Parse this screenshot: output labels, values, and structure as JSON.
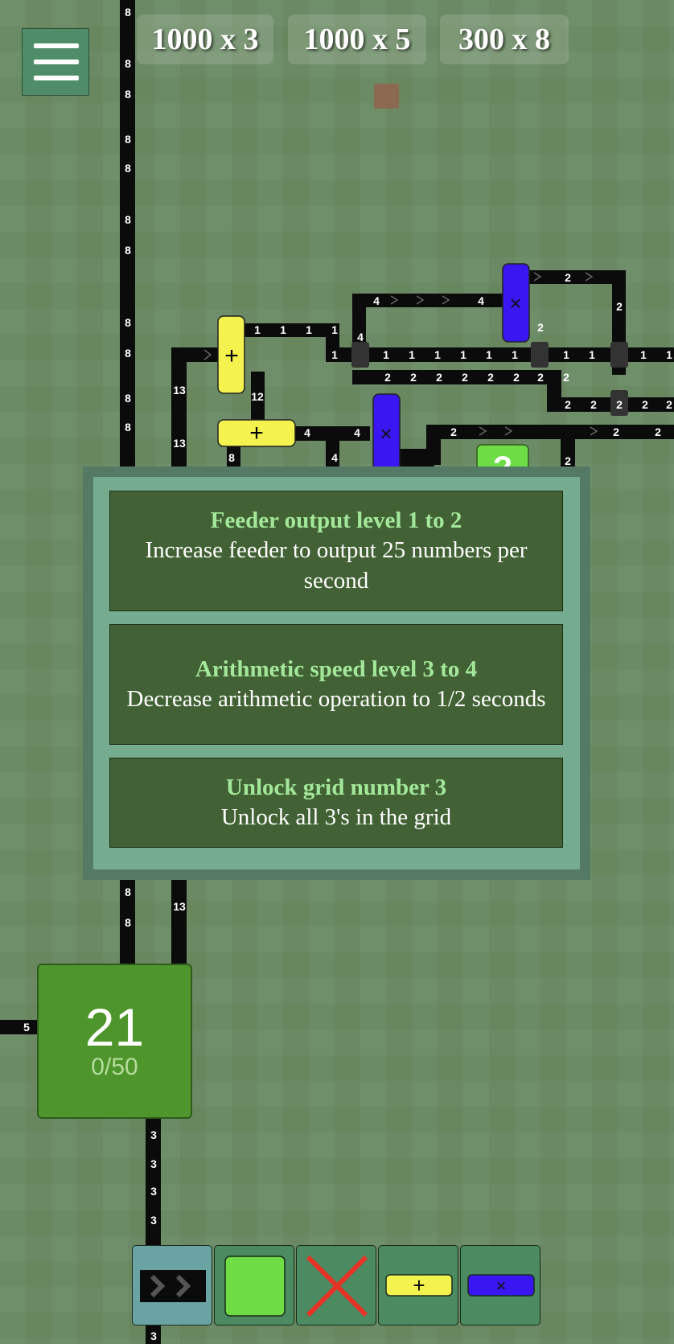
{
  "top_bar": {
    "options": [
      {
        "label": "1000 x 3"
      },
      {
        "label": "1000 x 5"
      },
      {
        "label": "300 x 8"
      }
    ]
  },
  "board": {
    "belt_labels": {
      "main_left": "8",
      "second_left": "13",
      "goal_feed_left": "5",
      "goal_out": "3",
      "top_row_ones": "1",
      "top_row_fours": "4",
      "twos": "2",
      "twelve": "12",
      "eight_small": "8",
      "four_small": "4",
      "mystery_machine": "?"
    },
    "operators": {
      "plus": "+",
      "multiply": "×"
    }
  },
  "upgrade_dialog": {
    "options": [
      {
        "title": "Feeder output level 1 to 2",
        "description": "Increase feeder to output 25 numbers per second"
      },
      {
        "title": "Arithmetic speed level 3 to 4",
        "description": "Decrease arithmetic operation to 1/2 seconds"
      },
      {
        "title": "Unlock grid number 3",
        "description": "Unlock all 3's in the grid"
      }
    ]
  },
  "goal": {
    "number": "21",
    "progress": "0/50"
  },
  "toolbar": {
    "tools": [
      {
        "name": "conveyor-belt",
        "selected": true
      },
      {
        "name": "feeder-square",
        "selected": false
      },
      {
        "name": "delete",
        "selected": false
      },
      {
        "name": "add-operator",
        "label": "+",
        "selected": false
      },
      {
        "name": "multiply-operator",
        "label": "×",
        "selected": false
      }
    ]
  },
  "colors": {
    "background": "#6b8a66",
    "belt": "#0b0b0b",
    "plus_operator": "#f4f24e",
    "multiply_operator": "#3a17f2",
    "feeder_green": "#6ddc45",
    "goal_green": "#4e952c",
    "modal_inner": "#75ac90",
    "modal_border": "#547a66",
    "card_bg": "#426235",
    "card_title": "#a3e89a",
    "delete_red": "#e53426"
  }
}
